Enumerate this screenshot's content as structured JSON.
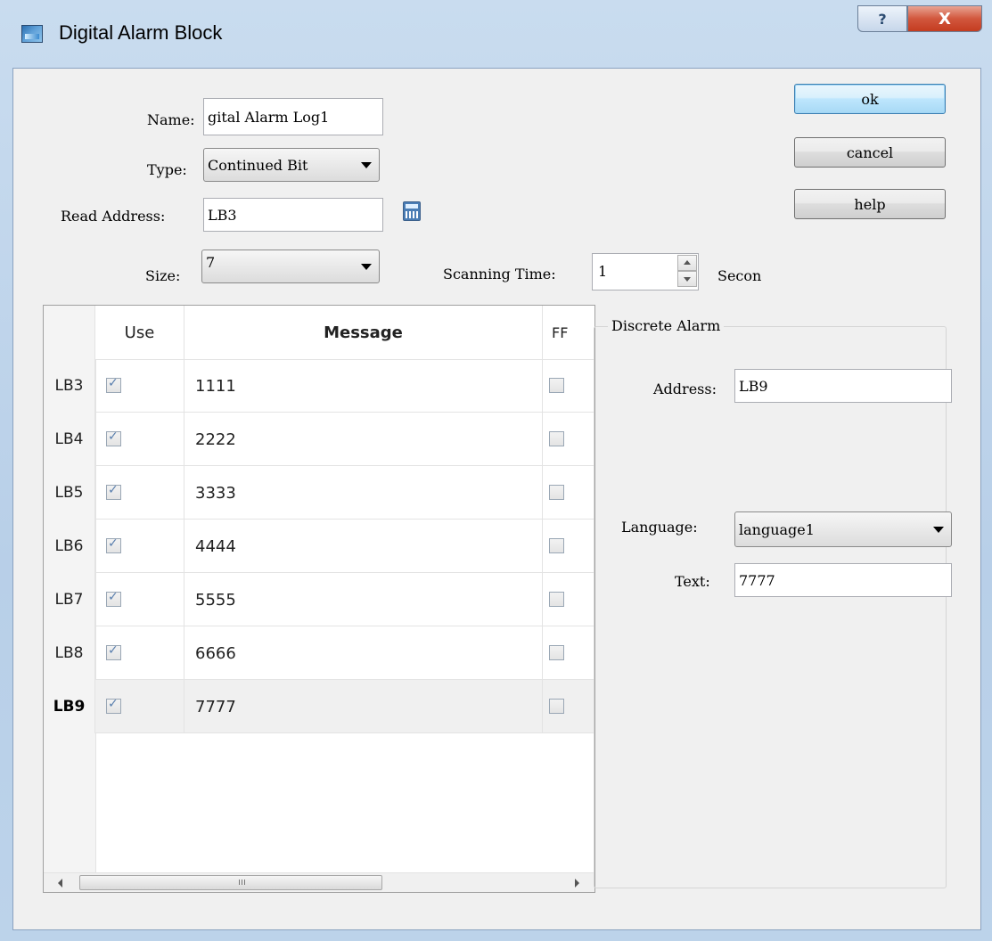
{
  "window": {
    "title": "Digital Alarm Block",
    "help_glyph": "?",
    "close_glyph": "X"
  },
  "form": {
    "name_label": "Name:",
    "name_value": "gital Alarm Log1",
    "type_label": "Type:",
    "type_value": "Continued Bit",
    "read_address_label": "Read Address:",
    "read_address_value": "LB3",
    "size_label": "Size:",
    "size_value": "7",
    "scanning_time_label": "Scanning Time:",
    "scanning_time_value": "1",
    "scanning_time_unit": "Secon"
  },
  "buttons": {
    "ok": "ok",
    "cancel": "cancel",
    "help": "help"
  },
  "grid": {
    "columns": {
      "use": "Use",
      "message": "Message",
      "ff": "FF"
    },
    "rows": [
      {
        "header": "LB3",
        "use": true,
        "message": "1111",
        "ff": false
      },
      {
        "header": "LB4",
        "use": true,
        "message": "2222",
        "ff": false
      },
      {
        "header": "LB5",
        "use": true,
        "message": "3333",
        "ff": false
      },
      {
        "header": "LB6",
        "use": true,
        "message": "4444",
        "ff": false
      },
      {
        "header": "LB7",
        "use": true,
        "message": "5555",
        "ff": false
      },
      {
        "header": "LB8",
        "use": true,
        "message": "6666",
        "ff": false
      },
      {
        "header": "LB9",
        "use": true,
        "message": "7777",
        "ff": false
      }
    ],
    "selected_row": "LB9",
    "scroll_grip": "III"
  },
  "discrete_alarm": {
    "title": "Discrete Alarm",
    "address_label": "Address:",
    "address_value": "LB9",
    "language_label": "Language:",
    "language_value": "language1",
    "text_label": "Text:",
    "text_value": "7777"
  }
}
